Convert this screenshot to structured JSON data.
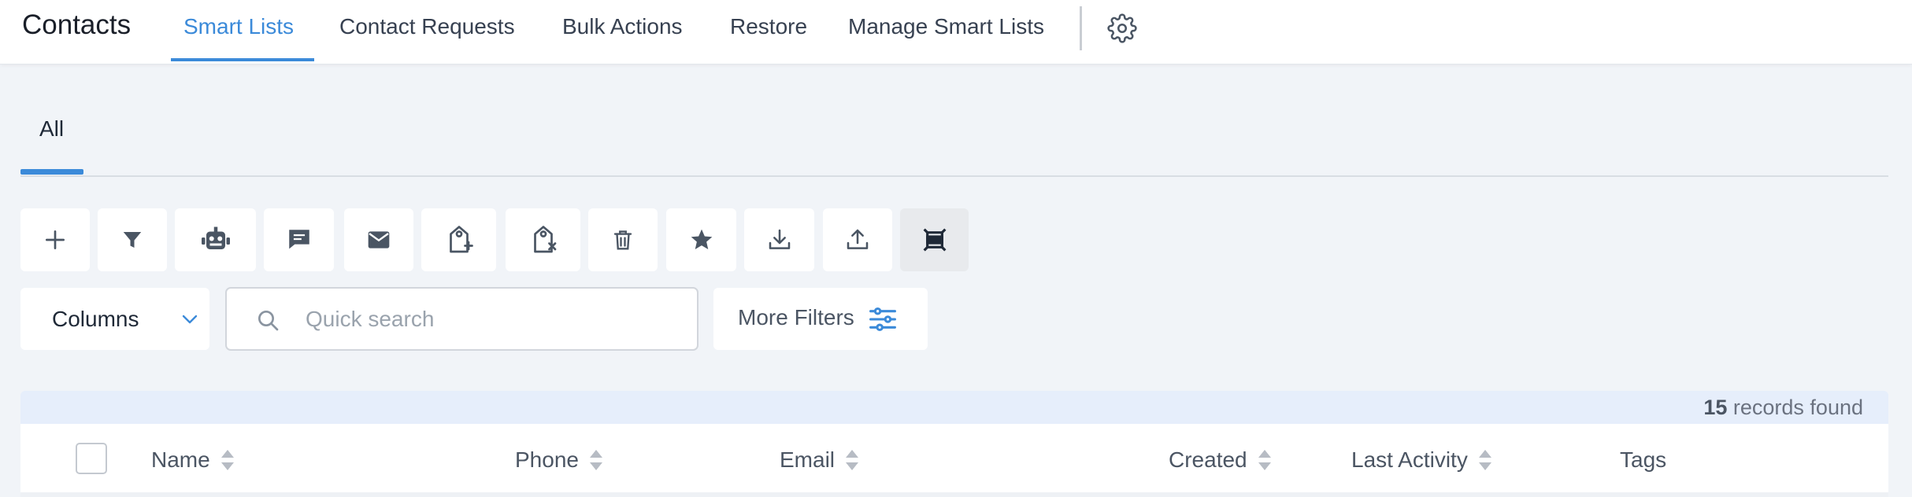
{
  "app": {
    "title": "Contacts"
  },
  "nav": {
    "tabs": [
      {
        "label": "Smart Lists",
        "active": true
      },
      {
        "label": "Contact Requests",
        "active": false
      },
      {
        "label": "Bulk Actions",
        "active": false
      },
      {
        "label": "Restore",
        "active": false
      },
      {
        "label": "Manage Smart Lists",
        "active": false
      }
    ],
    "settings_icon": "gear-icon"
  },
  "subtabs": [
    {
      "label": "All",
      "active": true
    }
  ],
  "toolbar": {
    "buttons": [
      {
        "icon": "plus-icon"
      },
      {
        "icon": "filter-icon"
      },
      {
        "icon": "robot-icon"
      },
      {
        "icon": "message-icon"
      },
      {
        "icon": "mail-icon"
      },
      {
        "icon": "add-tag-icon"
      },
      {
        "icon": "remove-tag-icon"
      },
      {
        "icon": "trash-icon"
      },
      {
        "icon": "star-icon"
      },
      {
        "icon": "download-icon"
      },
      {
        "icon": "upload-icon"
      },
      {
        "icon": "merge-icon",
        "active": true
      }
    ]
  },
  "columns_button": {
    "label": "Columns"
  },
  "search": {
    "placeholder": "Quick search",
    "value": ""
  },
  "more_filters": {
    "label": "More Filters"
  },
  "records": {
    "count": "15",
    "suffix": " records found"
  },
  "table": {
    "columns": [
      "Name",
      "Phone",
      "Email",
      "Created",
      "Last Activity",
      "Tags"
    ]
  },
  "colors": {
    "accent": "#3b8ad9",
    "background": "#f1f4f8",
    "icon": "#4a5563"
  }
}
